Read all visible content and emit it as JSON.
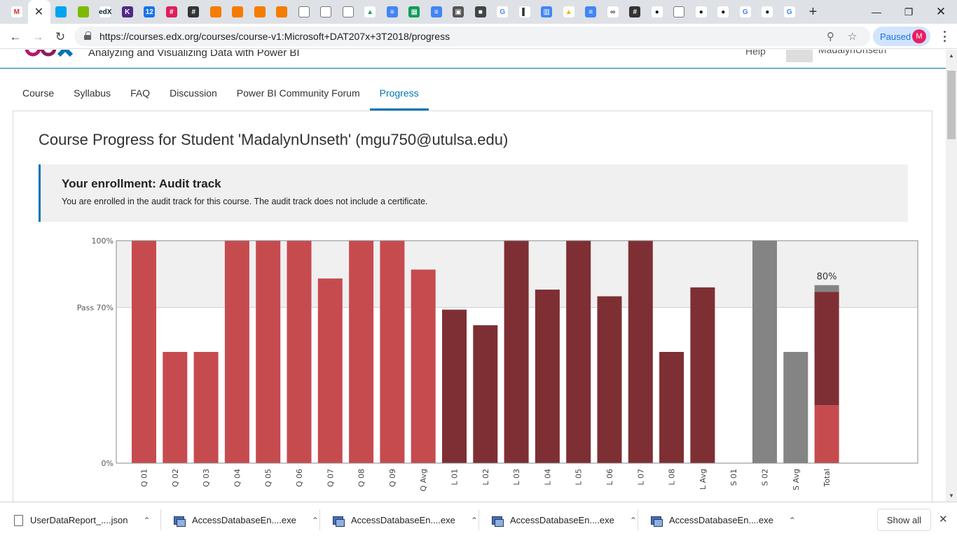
{
  "browser": {
    "tabs": [
      {
        "icon": "gmail-icon",
        "glyph": "M",
        "color": "#ffffff",
        "fg": "#d93025"
      },
      {
        "icon": "close-tab-icon",
        "glyph": "✕",
        "active": true
      },
      {
        "icon": "windows-icon",
        "glyph": "",
        "color": "#00a4ef"
      },
      {
        "icon": "windows-icon",
        "glyph": "",
        "color": "#7fba00"
      },
      {
        "icon": "edx-icon",
        "glyph": "edX",
        "color": "#ffffff",
        "fg": "#02262b"
      },
      {
        "icon": "kstate-icon",
        "glyph": "K",
        "color": "#512888"
      },
      {
        "icon": "calendar-icon",
        "glyph": "12",
        "color": "#1a73e8"
      },
      {
        "icon": "slack-icon",
        "glyph": "#",
        "color": "#e01e5a"
      },
      {
        "icon": "hashtag-icon",
        "glyph": "#",
        "color": "#333333"
      },
      {
        "icon": "cube-icon",
        "glyph": "",
        "color": "#f57c00"
      },
      {
        "icon": "cube-icon",
        "glyph": "",
        "color": "#f57c00"
      },
      {
        "icon": "cube-icon",
        "glyph": "",
        "color": "#f57c00"
      },
      {
        "icon": "cube-icon",
        "glyph": "",
        "color": "#f57c00"
      },
      {
        "icon": "page-icon",
        "glyph": "",
        "color": "#ffffff"
      },
      {
        "icon": "page-icon",
        "glyph": "",
        "color": "#ffffff"
      },
      {
        "icon": "page-icon",
        "glyph": "",
        "color": "#ffffff"
      },
      {
        "icon": "drive-icon",
        "glyph": "▲",
        "color": "#ffffff",
        "fg": "#1fa463"
      },
      {
        "icon": "docs-icon",
        "glyph": "≡",
        "color": "#4285f4"
      },
      {
        "icon": "sheets-icon",
        "glyph": "▦",
        "color": "#0f9d58"
      },
      {
        "icon": "docs-icon",
        "glyph": "≡",
        "color": "#4285f4"
      },
      {
        "icon": "photo-icon",
        "glyph": "▣",
        "color": "#555555"
      },
      {
        "icon": "box-icon",
        "glyph": "■",
        "color": "#444444"
      },
      {
        "icon": "google-icon",
        "glyph": "G",
        "color": "#ffffff",
        "fg": "#4285f4"
      },
      {
        "icon": "chart-icon",
        "glyph": "▌",
        "color": "#ffffff",
        "fg": "#333333"
      },
      {
        "icon": "books-icon",
        "glyph": "▥",
        "color": "#4285f4"
      },
      {
        "icon": "drive-icon",
        "glyph": "▲",
        "color": "#ffffff",
        "fg": "#f4b400"
      },
      {
        "icon": "docs-icon",
        "glyph": "≡",
        "color": "#4285f4"
      },
      {
        "icon": "link-icon",
        "glyph": "∞",
        "color": "#ffffff",
        "fg": "#333333"
      },
      {
        "icon": "hashtag-icon",
        "glyph": "#",
        "color": "#333333"
      },
      {
        "icon": "github-icon",
        "glyph": "●",
        "color": "#ffffff",
        "fg": "#181717"
      },
      {
        "icon": "page-icon",
        "glyph": "",
        "color": "#ffffff"
      },
      {
        "icon": "github-icon",
        "glyph": "●",
        "color": "#ffffff",
        "fg": "#181717"
      },
      {
        "icon": "github-icon",
        "glyph": "●",
        "color": "#ffffff",
        "fg": "#181717"
      },
      {
        "icon": "google-icon",
        "glyph": "G",
        "color": "#ffffff",
        "fg": "#4285f4"
      },
      {
        "icon": "github-icon",
        "glyph": "●",
        "color": "#ffffff",
        "fg": "#181717"
      },
      {
        "icon": "google-icon",
        "glyph": "G",
        "color": "#ffffff",
        "fg": "#4285f4"
      }
    ],
    "new_tab": "+",
    "url": "https://courses.edx.org/courses/course-v1:Microsoft+DAT207x+3T2018/progress",
    "sync_status": "Paused",
    "profile_initial": "M"
  },
  "header": {
    "course_title": "Analyzing and Visualizing Data with Power BI",
    "help": "Help",
    "username": "MadalynUnseth"
  },
  "nav": {
    "items": [
      "Course",
      "Syllabus",
      "FAQ",
      "Discussion",
      "Power BI Community Forum",
      "Progress"
    ],
    "active": "Progress"
  },
  "progress": {
    "title": "Course Progress for Student 'MadalynUnseth' (mgu750@utulsa.edu)",
    "enrollment_heading": "Your enrollment: Audit track",
    "enrollment_text": "You are enrolled in the audit track for this course. The audit track does not include a certificate."
  },
  "chart_data": {
    "type": "bar",
    "ylim": [
      0,
      100
    ],
    "y_ticks": [
      {
        "value": 100,
        "label": "100%"
      },
      {
        "value": 70,
        "label": "Pass 70%"
      },
      {
        "value": 0,
        "label": "0%"
      }
    ],
    "pass_threshold": 70,
    "categories": [
      "Q 01",
      "Q 02",
      "Q 03",
      "Q 04",
      "Q 05",
      "Q 06",
      "Q 07",
      "Q 08",
      "Q 09",
      "Q Avg",
      "L 01",
      "L 02",
      "L 03",
      "L 04",
      "L 05",
      "L 06",
      "L 07",
      "L 08",
      "L Avg",
      "S 01",
      "S 02",
      "S Avg",
      "Total"
    ],
    "values": [
      100,
      50,
      50,
      100,
      100,
      100,
      83,
      100,
      100,
      87,
      69,
      62,
      100,
      78,
      100,
      75,
      100,
      50,
      79,
      0,
      100,
      50,
      null
    ],
    "groups": [
      "Q",
      "Q",
      "Q",
      "Q",
      "Q",
      "Q",
      "Q",
      "Q",
      "Q",
      "Q",
      "L",
      "L",
      "L",
      "L",
      "L",
      "L",
      "L",
      "L",
      "L",
      "S",
      "S",
      "S",
      "T"
    ],
    "group_colors": {
      "Q": "#c64b4f",
      "L": "#7e2f33",
      "S": "#848484"
    },
    "total": {
      "label": "80%",
      "segments": [
        {
          "group": "Q",
          "value": 26
        },
        {
          "group": "L",
          "value": 51
        },
        {
          "group": "S",
          "value": 3
        }
      ]
    },
    "grid": false
  },
  "downloads": [
    {
      "name": "UserDataReport_....json",
      "icon": "json-file-icon"
    },
    {
      "name": "AccessDatabaseEn....exe",
      "icon": "exe-file-icon"
    },
    {
      "name": "AccessDatabaseEn....exe",
      "icon": "exe-file-icon"
    },
    {
      "name": "AccessDatabaseEn....exe",
      "icon": "exe-file-icon"
    },
    {
      "name": "AccessDatabaseEn....exe",
      "icon": "exe-file-icon"
    }
  ],
  "shelf": {
    "show_all": "Show all"
  }
}
